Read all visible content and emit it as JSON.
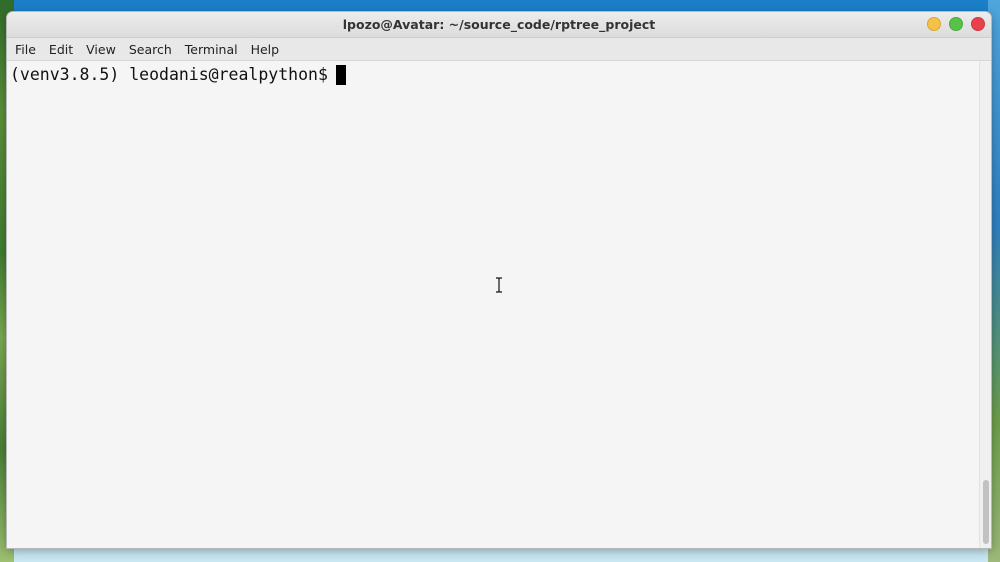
{
  "window": {
    "title": "lpozo@Avatar: ~/source_code/rptree_project",
    "controls": [
      {
        "name": "minimize",
        "icon": "minimize-icon",
        "color": "#f5c044"
      },
      {
        "name": "maximize",
        "icon": "maximize-icon",
        "color": "#58c14a"
      },
      {
        "name": "close",
        "icon": "close-icon",
        "color": "#e9414c"
      }
    ]
  },
  "menubar": {
    "items": [
      "File",
      "Edit",
      "View",
      "Search",
      "Terminal",
      "Help"
    ]
  },
  "terminal": {
    "prompt": "(venv3.8.5) leodanis@realpython$",
    "input": ""
  }
}
